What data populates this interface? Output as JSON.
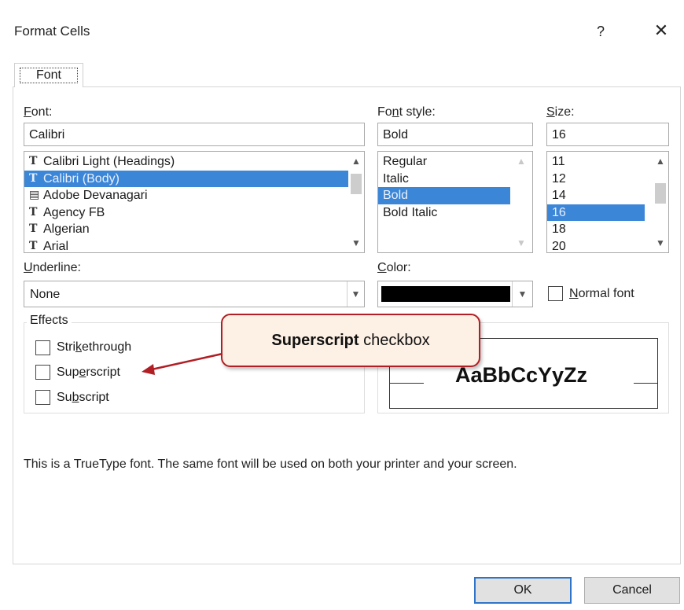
{
  "dialog": {
    "title": "Format Cells",
    "help_label": "?",
    "close_label": "✕"
  },
  "tabs": [
    {
      "label": "Font",
      "active": true
    }
  ],
  "font": {
    "label": "Font:",
    "value": "Calibri",
    "items": [
      {
        "label": "Calibri Light (Headings)",
        "icon": "truetype-icon",
        "selected": false
      },
      {
        "label": "Calibri (Body)",
        "icon": "truetype-icon",
        "selected": true
      },
      {
        "label": "Adobe Devanagari",
        "icon": "opentype-icon",
        "selected": false
      },
      {
        "label": "Agency FB",
        "icon": "truetype-icon",
        "selected": false
      },
      {
        "label": "Algerian",
        "icon": "truetype-icon",
        "selected": false
      },
      {
        "label": "Arial",
        "icon": "truetype-icon",
        "selected": false
      }
    ]
  },
  "font_style": {
    "label": "Font style:",
    "value": "Bold",
    "items": [
      {
        "label": "Regular",
        "selected": false
      },
      {
        "label": "Italic",
        "selected": false
      },
      {
        "label": "Bold",
        "selected": true
      },
      {
        "label": "Bold Italic",
        "selected": false
      }
    ]
  },
  "size": {
    "label": "Size:",
    "value": "16",
    "items": [
      {
        "label": "11",
        "selected": false
      },
      {
        "label": "12",
        "selected": false
      },
      {
        "label": "14",
        "selected": false
      },
      {
        "label": "16",
        "selected": true
      },
      {
        "label": "18",
        "selected": false
      },
      {
        "label": "20",
        "selected": false
      }
    ]
  },
  "underline": {
    "label": "Underline:",
    "value": "None"
  },
  "color": {
    "label": "Color:",
    "value": "#000000"
  },
  "normal_font": {
    "label": "Normal font",
    "checked": false
  },
  "effects": {
    "title": "Effects",
    "items": [
      {
        "label": "Strikethrough",
        "checked": false
      },
      {
        "label": "Superscript",
        "checked": false
      },
      {
        "label": "Subscript",
        "checked": false
      }
    ]
  },
  "preview": {
    "sample_text": "AaBbCcYyZz"
  },
  "callout": {
    "bold_text": "Superscript",
    "text": " checkbox",
    "border_color": "#b11e24"
  },
  "info_text": "This is a TrueType font.  The same font will be used on both your printer and your screen.",
  "buttons": {
    "ok": "OK",
    "cancel": "Cancel"
  },
  "colors": {
    "selection": "#3c86d8",
    "default_button_border": "#2e75c9"
  }
}
